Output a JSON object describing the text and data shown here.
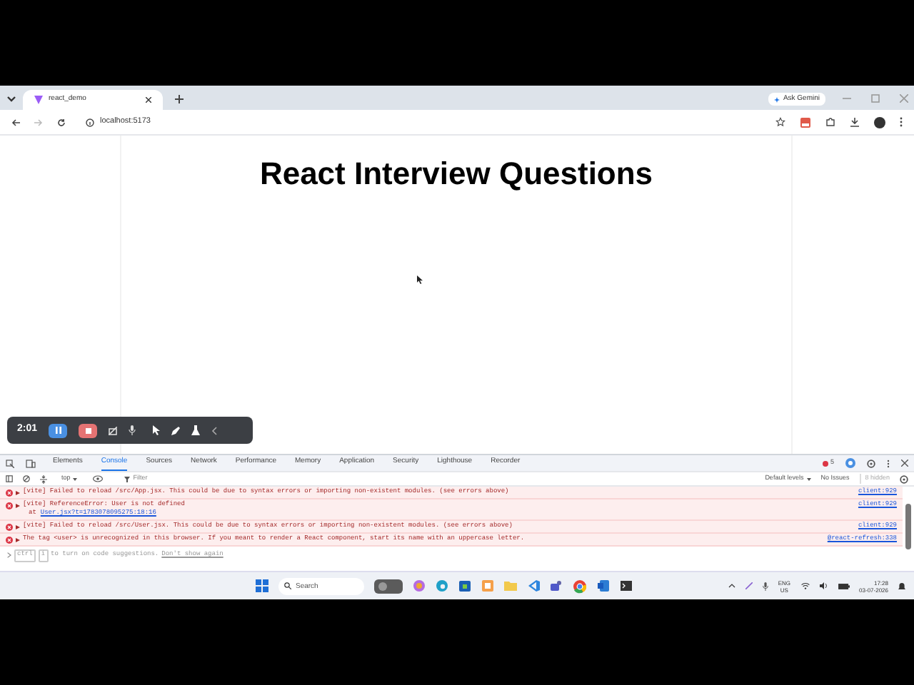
{
  "browser": {
    "tab": {
      "title": "react_demo"
    },
    "ask_gemini": "Ask Gemini",
    "address": "localhost:5173"
  },
  "page": {
    "heading": "React Interview Questions"
  },
  "recorder": {
    "time": "2:01"
  },
  "devtools": {
    "tabs": [
      {
        "label": "Elements",
        "selected": false
      },
      {
        "label": "Console",
        "selected": true
      },
      {
        "label": "Sources",
        "selected": false
      },
      {
        "label": "Network",
        "selected": false
      },
      {
        "label": "Performance",
        "selected": false
      },
      {
        "label": "Memory",
        "selected": false
      },
      {
        "label": "Application",
        "selected": false
      },
      {
        "label": "Security",
        "selected": false
      },
      {
        "label": "Lighthouse",
        "selected": false
      },
      {
        "label": "Recorder",
        "selected": false
      }
    ],
    "error_count": "5",
    "context": "top",
    "filter": {
      "placeholder": "Filter"
    },
    "levels": "Default levels",
    "issues": "No Issues",
    "hidden": "8 hidden",
    "messages": [
      {
        "text": "[vite] Failed to reload /src/App.jsx. This could be due to syntax errors or importing non-existent modules. (see errors above)",
        "source": "client:929"
      },
      {
        "text": "[vite] ReferenceError: User is not defined",
        "trace_prefix": "at",
        "trace_link": "User.jsx?t=1783078095275:18:16",
        "source": "client:929"
      },
      {
        "text": "[vite] Failed to reload /src/User.jsx. This could be due to syntax errors or importing non-existent modules. (see errors above)",
        "source": "client:929"
      },
      {
        "text": "The tag <user> is unrecognized in this browser. If you meant to render a React component, start its name with an uppercase letter.",
        "source": "@react-refresh:338"
      }
    ],
    "prompt": {
      "key1": "ctrl",
      "key2": "i",
      "text": "to turn on code suggestions.",
      "link": "Don't show again"
    }
  },
  "taskbar": {
    "search": {
      "placeholder": "Search"
    },
    "language": "ENG",
    "region": "US",
    "time": "17:28",
    "date": "03-07-2026"
  }
}
